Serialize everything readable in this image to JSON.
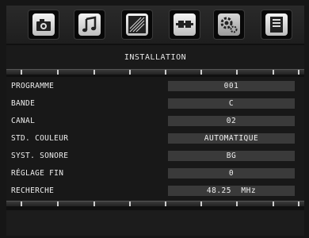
{
  "menu": {
    "icons": [
      {
        "name": "picture-icon"
      },
      {
        "name": "sound-icon"
      },
      {
        "name": "screen-icon"
      },
      {
        "name": "connection-icon"
      },
      {
        "name": "settings-icon",
        "selected": true
      },
      {
        "name": "info-icon"
      }
    ],
    "title": "INSTALLATION"
  },
  "settings": [
    {
      "label": "PROGRAMME",
      "value": "001"
    },
    {
      "label": "BANDE",
      "value": "C"
    },
    {
      "label": "CANAL",
      "value": "02"
    },
    {
      "label": "STD. COULEUR",
      "value": "AUTOMATIQUE"
    },
    {
      "label": "SYST. SONORE",
      "value": "BG"
    },
    {
      "label": "RÉGLAGE FIN",
      "value": "0"
    },
    {
      "label": "RECHERCHE",
      "value": "48.25  MHz"
    }
  ],
  "colors": {
    "background": "#101010",
    "value_box": "#3a3a3a",
    "text": "#e8e8e8"
  }
}
